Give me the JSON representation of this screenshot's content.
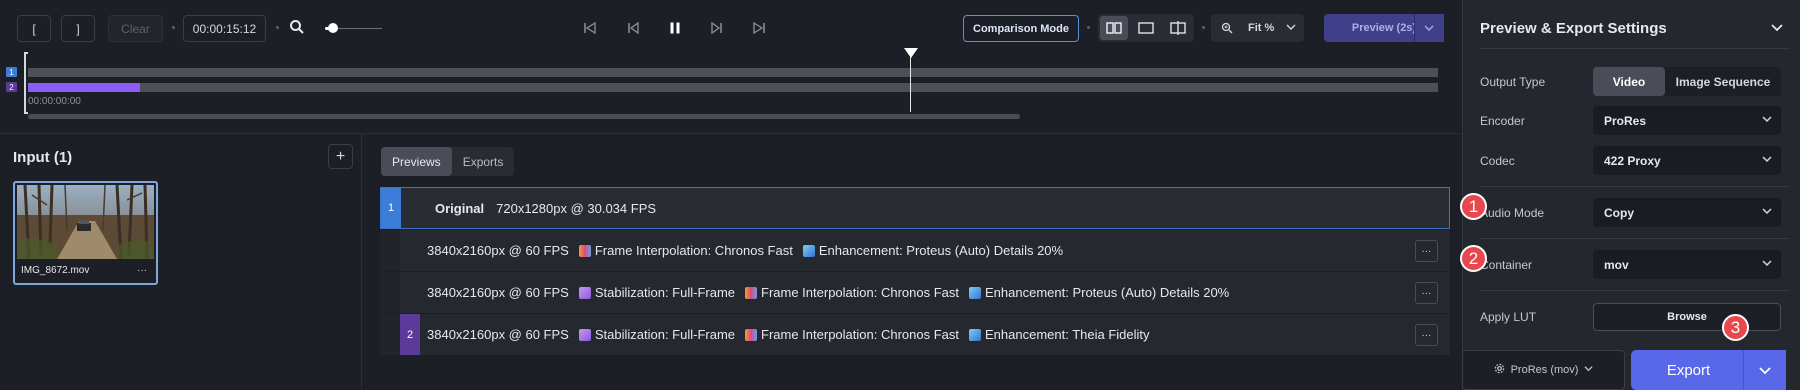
{
  "transport": {
    "in_point_label": "[",
    "out_point_label": "]",
    "clear_label": "Clear",
    "timecode": "00:00:15:12",
    "zoom_level": 0.18,
    "comparison_mode_label": "Comparison Mode",
    "fit_label": "Fit %",
    "preview_label": "Preview (2s)"
  },
  "timeline": {
    "track_labels": [
      "1",
      "2"
    ],
    "track_colors": [
      "#3b7dd8",
      "#8b5cf6"
    ],
    "start_time": "00:00:00:00"
  },
  "input_panel": {
    "title": "Input (1)",
    "add_label": "+",
    "file_name": "IMG_8672.mov",
    "more_label": "···"
  },
  "center": {
    "tabs": [
      {
        "label": "Previews",
        "active": true
      },
      {
        "label": "Exports",
        "active": false
      }
    ],
    "rows": [
      {
        "num": "1",
        "num_color": "#3b7dd8",
        "name": "Original",
        "spec": "720x1280px @ 30.034 FPS"
      },
      {
        "num": "",
        "spec": "3840x2160px @ 60 FPS",
        "features": [
          {
            "icon": "frame-interpolation-icon",
            "label": "Frame Interpolation: Chronos Fast"
          },
          {
            "icon": "enhancement-icon",
            "label": "Enhancement: Proteus (Auto) Details 20%"
          }
        ]
      },
      {
        "num": "",
        "spec": "3840x2160px @ 60 FPS",
        "features": [
          {
            "icon": "stabilization-icon",
            "label": "Stabilization: Full-Frame"
          },
          {
            "icon": "frame-interpolation-icon",
            "label": "Frame Interpolation: Chronos Fast"
          },
          {
            "icon": "enhancement-icon",
            "label": "Enhancement: Proteus (Auto) Details 20%"
          }
        ]
      },
      {
        "num": "2",
        "num_color": "#5b3a9a",
        "spec": "3840x2160px @ 60 FPS",
        "features": [
          {
            "icon": "stabilization-icon",
            "label": "Stabilization: Full-Frame"
          },
          {
            "icon": "frame-interpolation-icon",
            "label": "Frame Interpolation: Chronos Fast"
          },
          {
            "icon": "enhancement-icon",
            "label": "Enhancement: Theia Fidelity"
          }
        ]
      }
    ],
    "more_label": "···"
  },
  "export_panel": {
    "title": "Preview & Export Settings",
    "output_type_label": "Output Type",
    "output_types": [
      "Video",
      "Image Sequence"
    ],
    "encoder_label": "Encoder",
    "encoder_value": "ProRes",
    "codec_label": "Codec",
    "codec_value": "422 Proxy",
    "audio_mode_label": "Audio Mode",
    "audio_mode_value": "Copy",
    "container_label": "Container",
    "container_value": "mov",
    "lut_label": "Apply LUT",
    "browse_label": "Browse",
    "preset_label": "ProRes (mov)",
    "export_label": "Export"
  },
  "badges": [
    "1",
    "2",
    "3"
  ],
  "colors": {
    "accent_blue": "#3b7dd8",
    "accent_purple": "#8b5cf6",
    "export_button": "#5868e8",
    "badge_red": "#e8484d"
  }
}
